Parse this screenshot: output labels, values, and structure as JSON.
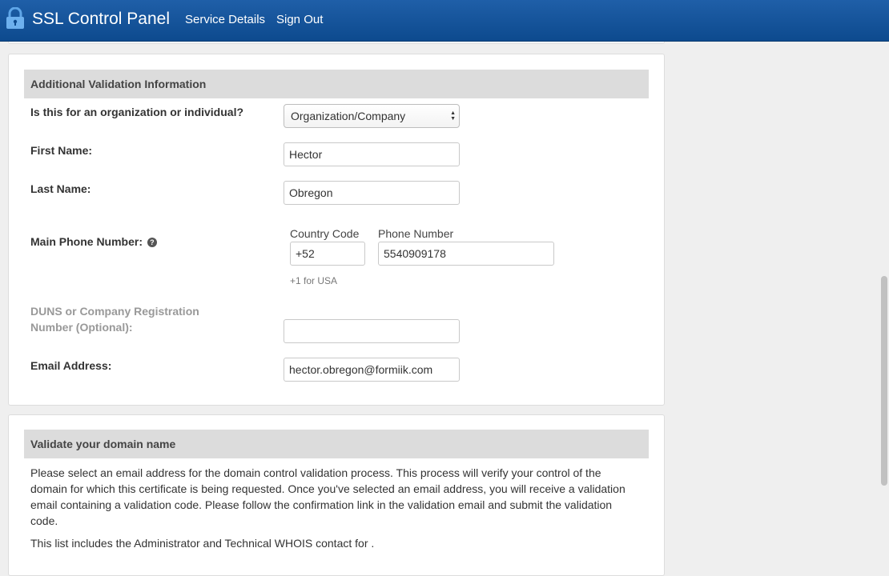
{
  "header": {
    "title": "SSL Control Panel",
    "nav": [
      "Service Details",
      "Sign Out"
    ]
  },
  "validation": {
    "heading": "Additional Validation Information",
    "org_question": "Is this for an organization or individual?",
    "org_selected": "Organization/Company",
    "first_name_label": "First Name:",
    "first_name_value": "Hector",
    "last_name_label": "Last Name:",
    "last_name_value": "Obregon",
    "phone_label": "Main Phone Number:",
    "country_code_label": "Country Code",
    "country_code_value": "+52",
    "phone_number_label": "Phone Number",
    "phone_number_value": "5540909178",
    "usa_hint": "+1 for USA",
    "duns_label_line1": "DUNS or Company Registration",
    "duns_label_line2": "Number (Optional):",
    "duns_value": "",
    "email_label": "Email Address:",
    "email_value": "hector.obregon@formiik.com"
  },
  "domain": {
    "heading": "Validate your domain name",
    "paragraph": "Please select an email address for the domain control validation process. This process will verify your control of the domain for which this certificate is being requested. Once you've selected an email address, you will receive a validation email containing a validation code. Please follow the confirmation link in the validation email and submit the validation code.",
    "whois_note": "This list includes the Administrator and Technical WHOIS contact for ."
  },
  "colors": {
    "header_bg": "#0d4a8e",
    "section_head_bg": "#dcdcdc",
    "page_bg": "#efefef"
  },
  "icons": [
    "lock-icon",
    "help-icon",
    "select-arrows-icon"
  ]
}
